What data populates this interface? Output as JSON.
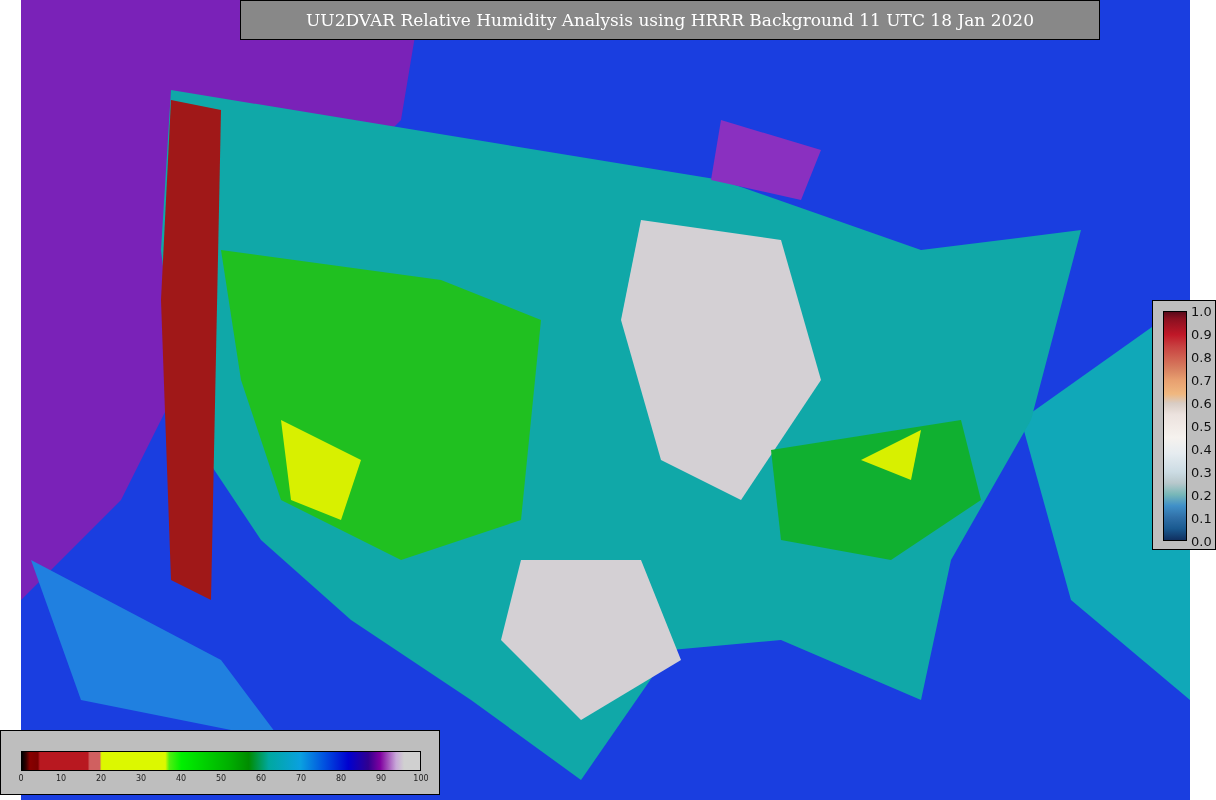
{
  "title": "UU2DVAR Relative Humidity Analysis using HRRR Background 11 UTC 18 Jan 2020",
  "humidity_legend": {
    "ticks": [
      "0",
      "10",
      "20",
      "30",
      "40",
      "50",
      "60",
      "70",
      "80",
      "90",
      "100"
    ]
  },
  "station_legend": {
    "ticks": [
      "1.0",
      "0.9",
      "0.8",
      "0.7",
      "0.6",
      "0.5",
      "0.4",
      "0.3",
      "0.2",
      "0.1",
      "0.0"
    ]
  }
}
